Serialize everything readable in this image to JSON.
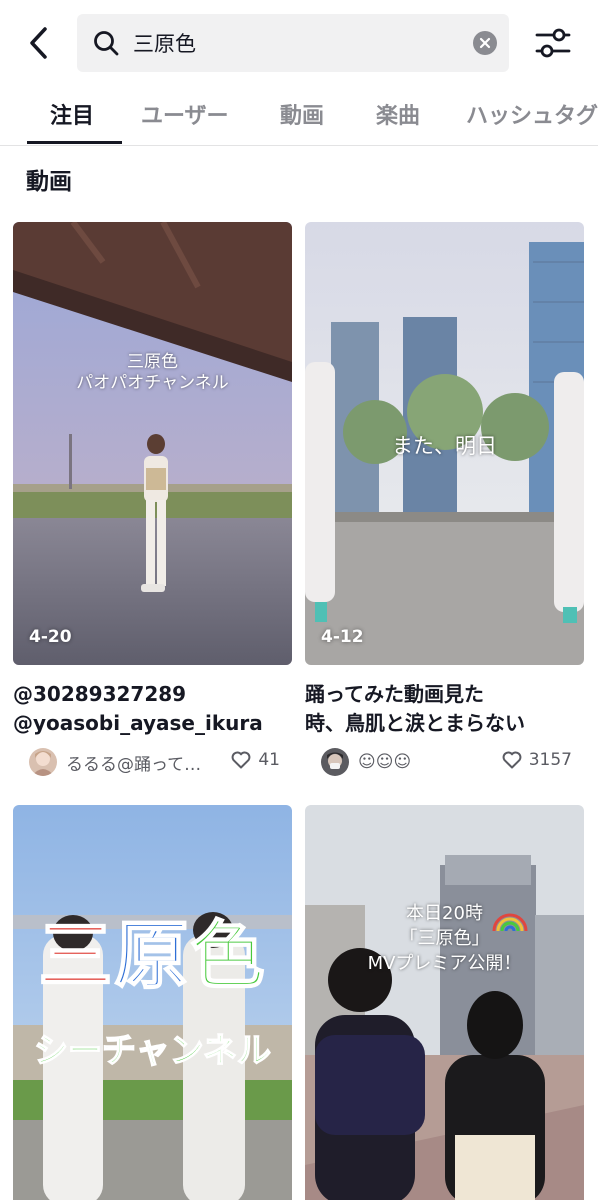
{
  "search": {
    "query": "三原色",
    "back_icon": "chevron-left-icon",
    "search_icon": "search-icon",
    "clear_icon": "clear-icon",
    "filter_icon": "sliders-icon"
  },
  "tabs": [
    {
      "label": "注目",
      "active": true
    },
    {
      "label": "ユーザー",
      "active": false
    },
    {
      "label": "動画",
      "active": false
    },
    {
      "label": "楽曲",
      "active": false
    },
    {
      "label": "ハッシュタグ",
      "active": false
    }
  ],
  "section": {
    "title": "動画"
  },
  "videos": [
    {
      "date": "4-20",
      "overlay_line1": "三原色",
      "overlay_line2": "パオパオチャンネル",
      "title_line1": "@30289327289",
      "title_line2": "@yoasobi_ayase_ikura",
      "author": "るるる@踊ってみた",
      "likes": "41"
    },
    {
      "date": "4-12",
      "overlay_line1": "また、明日",
      "title_line1": "踊ってみた動画見た",
      "title_line2": "時、鳥肌と涙とまらない",
      "author": "☺︎☺︎☺︎",
      "likes": "3157"
    },
    {
      "overlay_big": "三原色",
      "overlay_sub": "シーチャンネル"
    },
    {
      "overlay_line1": "本日20時",
      "overlay_line2": "「三原色」",
      "overlay_line3": "MVプレミア公開！"
    }
  ],
  "colors": {
    "text_primary": "#161823",
    "text_secondary": "#8a8b91",
    "search_bg": "#f1f1f2",
    "overlay_blue": "#2f6fd6",
    "overlay_green": "#49c93d",
    "overlay_red": "#e0463f"
  }
}
